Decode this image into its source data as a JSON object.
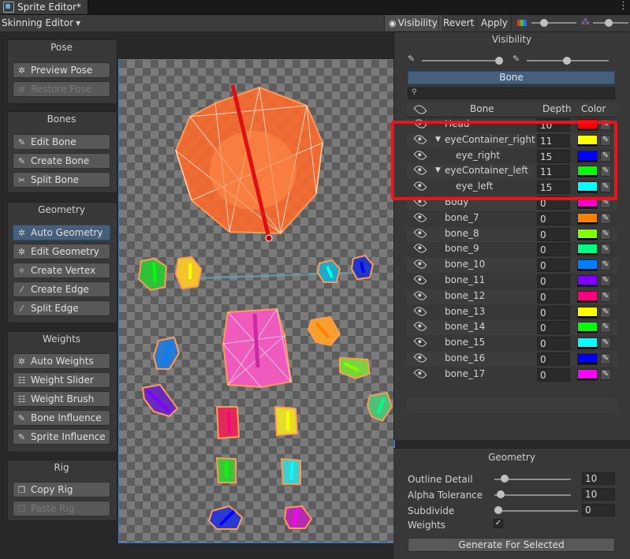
{
  "window": {
    "tab_title": "Sprite Editor*",
    "more_icon": "kebab-icon"
  },
  "toolbar": {
    "mode": "Skinning Editor",
    "visibility": "Visibility",
    "revert": "Revert",
    "apply": "Apply",
    "color_icon": "color-swatch-icon"
  },
  "tools": {
    "pose": {
      "title": "Pose",
      "preview": "Preview Pose",
      "restore": "Restore Pose"
    },
    "bones": {
      "title": "Bones",
      "edit": "Edit Bone",
      "create": "Create Bone",
      "split": "Split Bone"
    },
    "geometry": {
      "title": "Geometry",
      "auto": "Auto Geometry",
      "edit": "Edit Geometry",
      "vertex": "Create Vertex",
      "edge": "Create Edge",
      "split_edge": "Split Edge"
    },
    "weights": {
      "title": "Weights",
      "auto": "Auto Weights",
      "slider": "Weight Slider",
      "brush": "Weight Brush",
      "bone_influence": "Bone Influence",
      "sprite_influence": "Sprite Influence"
    },
    "rig": {
      "title": "Rig",
      "copy": "Copy Rig",
      "paste": "Paste Rig"
    }
  },
  "visibility": {
    "title": "Visibility",
    "tab": "Bone",
    "search_placeholder": "",
    "columns": {
      "bone": "Bone",
      "depth": "Depth",
      "color": "Color"
    },
    "rows": [
      {
        "name": "Head",
        "depth": "10",
        "color": "#ff0000"
      },
      {
        "name": "eyeContainer_right",
        "depth": "11",
        "color": "#ffff00",
        "expanded": true
      },
      {
        "name": "eye_right",
        "depth": "15",
        "color": "#0000ff"
      },
      {
        "name": "eyeContainer_left",
        "depth": "11",
        "color": "#00ff00",
        "expanded": true
      },
      {
        "name": "eye_left",
        "depth": "15",
        "color": "#00ffff"
      },
      {
        "name": "Body",
        "depth": "0",
        "color": "#ff00cc"
      },
      {
        "name": "bone_7",
        "depth": "0",
        "color": "#ff8000"
      },
      {
        "name": "bone_8",
        "depth": "0",
        "color": "#80ff00"
      },
      {
        "name": "bone_9",
        "depth": "0",
        "color": "#00ff80"
      },
      {
        "name": "bone_10",
        "depth": "0",
        "color": "#0080ff"
      },
      {
        "name": "bone_11",
        "depth": "0",
        "color": "#8000ff"
      },
      {
        "name": "bone_12",
        "depth": "0",
        "color": "#ff0080"
      },
      {
        "name": "bone_13",
        "depth": "0",
        "color": "#ffff00"
      },
      {
        "name": "bone_14",
        "depth": "0",
        "color": "#00ff00"
      },
      {
        "name": "bone_15",
        "depth": "0",
        "color": "#00ffff"
      },
      {
        "name": "bone_16",
        "depth": "0",
        "color": "#0000ff"
      },
      {
        "name": "bone_17",
        "depth": "0",
        "color": "#ff00ff"
      }
    ]
  },
  "geometry_panel": {
    "title": "Geometry",
    "outline_detail": {
      "label": "Outline Detail",
      "value": "10",
      "fraction": 0.1
    },
    "alpha_tolerance": {
      "label": "Alpha Tolerance",
      "value": "10",
      "fraction": 0.04
    },
    "subdivide": {
      "label": "Subdivide",
      "value": "0",
      "fraction": 0.0
    },
    "weights": {
      "label": "Weights",
      "checked": true
    },
    "generate": "Generate For Selected"
  },
  "highlight_color": "#e8141e",
  "accent_color": "#46607c"
}
